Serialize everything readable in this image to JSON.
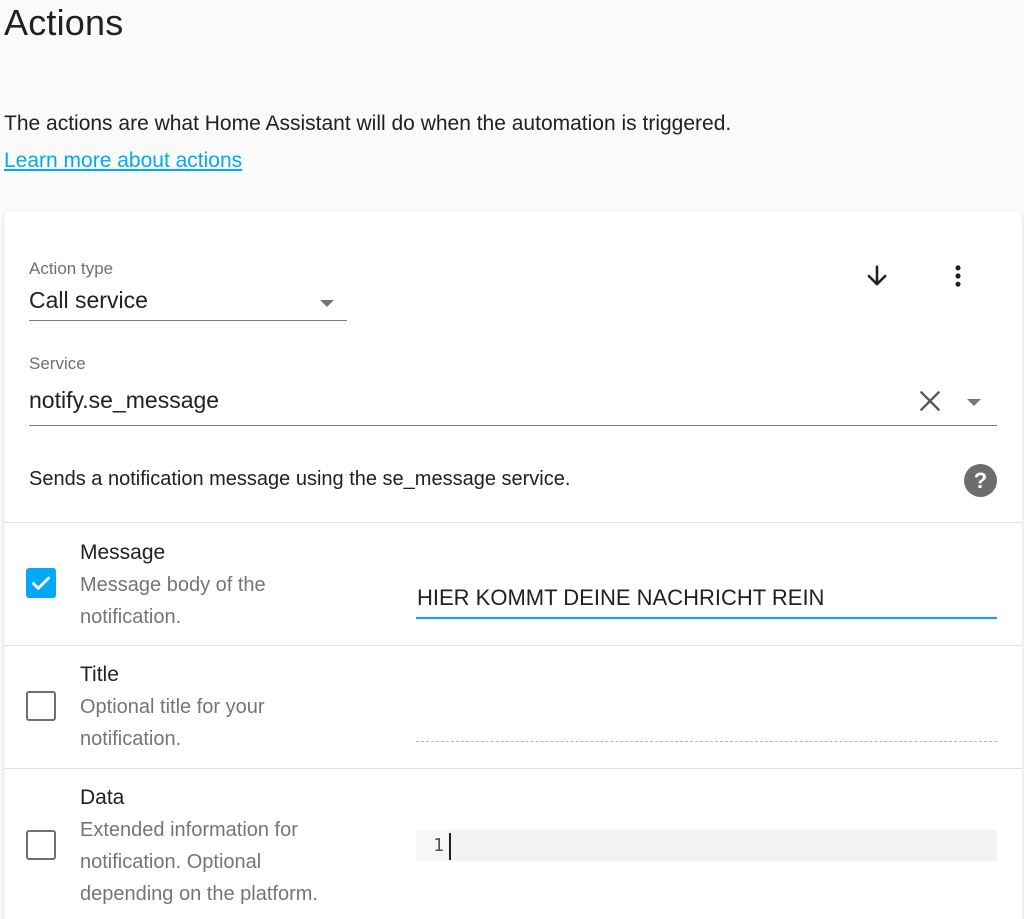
{
  "page": {
    "title": "Actions",
    "intro": "The actions are what Home Assistant will do when the automation is triggered.",
    "learn_more": "Learn more about actions"
  },
  "action": {
    "type_label": "Action type",
    "type_value": "Call service",
    "service_label": "Service",
    "service_value": "notify.se_message",
    "description": "Sends a notification message using the se_message service.",
    "help_glyph": "?"
  },
  "icons": {
    "move_down": "arrow-down-icon",
    "menu": "more-vertical-icon",
    "clear": "close-icon",
    "dropdown": "chevron-down-icon",
    "help": "help-circle-icon",
    "check": "check-icon"
  },
  "params": [
    {
      "name": "Message",
      "description": "Message body of the notification.",
      "checked": true,
      "value": "HIER KOMMT DEINE NACHRICHT REIN"
    },
    {
      "name": "Title",
      "description": "Optional title for your notification.",
      "checked": false,
      "value": ""
    },
    {
      "name": "Data",
      "description": "Extended information for notification. Optional depending on the platform.",
      "checked": false,
      "value": "",
      "line_number": "1"
    }
  ],
  "colors": {
    "accent": "#03a9f4",
    "background": "#fafafa",
    "card": "#ffffff",
    "help_icon": "#6d6d6d"
  }
}
